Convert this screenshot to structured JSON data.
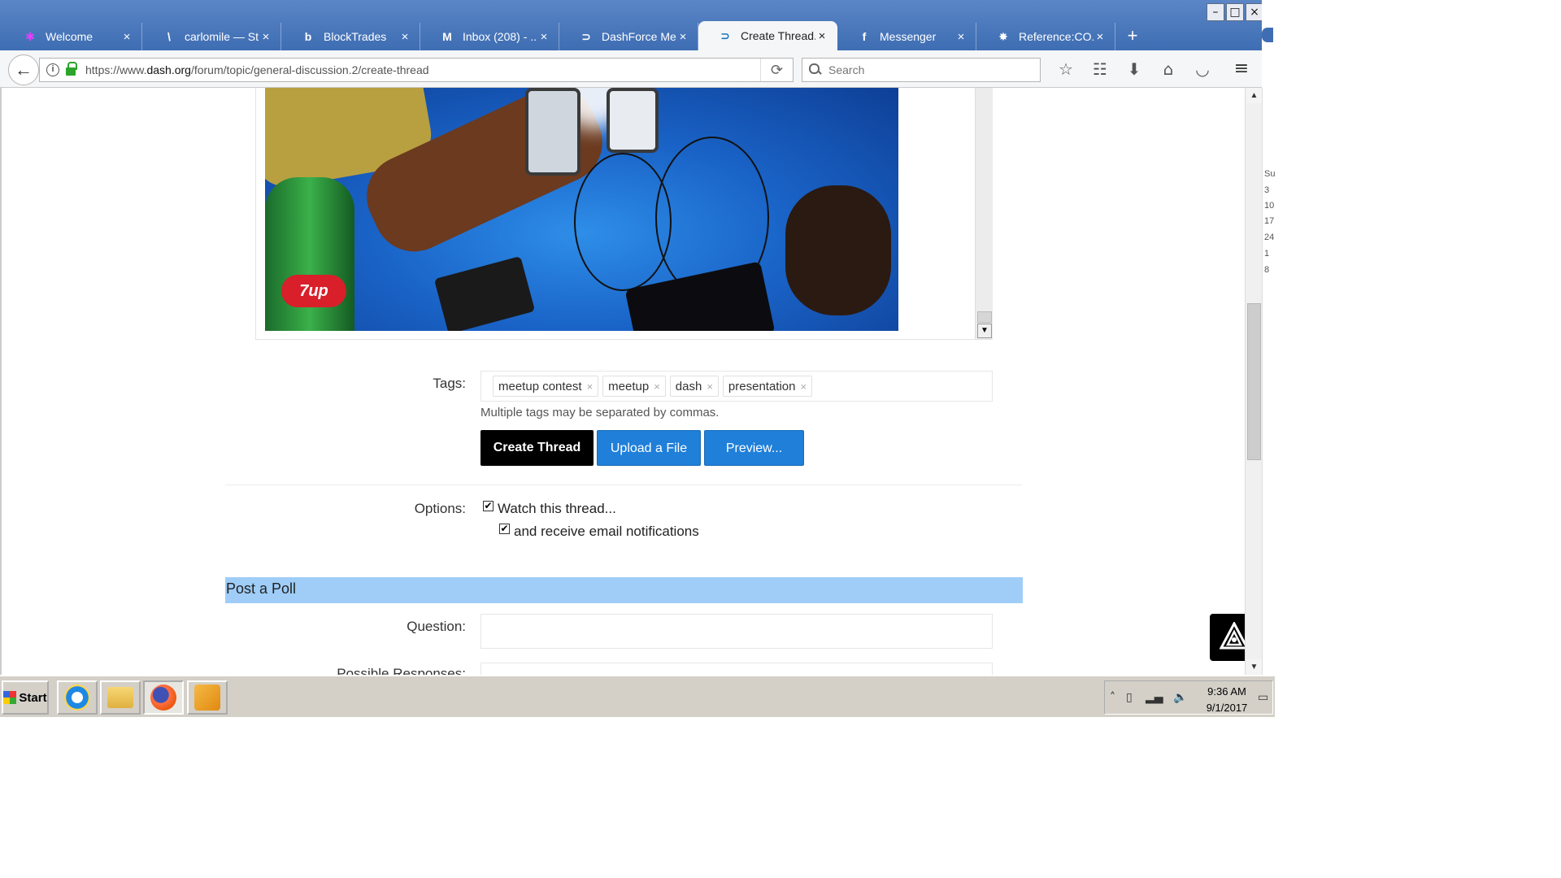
{
  "browser": {
    "tabs": [
      {
        "label": "Welcome",
        "icon": "asterisk-icon",
        "active": false
      },
      {
        "label": "carlomile — St...",
        "icon": "steemit-icon",
        "active": false
      },
      {
        "label": "BlockTrades",
        "icon": "blocktrades-icon",
        "active": false
      },
      {
        "label": "Inbox (208) - ...",
        "icon": "gmail-icon",
        "active": false
      },
      {
        "label": "DashForce Me...",
        "icon": "dash-icon",
        "active": false
      },
      {
        "label": "Create Thread...",
        "icon": "dash-icon",
        "active": true
      },
      {
        "label": "Messenger",
        "icon": "facebook-icon",
        "active": false
      },
      {
        "label": "Reference:CO...",
        "icon": "reference-icon",
        "active": false
      }
    ],
    "url_prefix": "https://www.",
    "url_domain": "dash.org",
    "url_path": "/forum/topic/general-discussion.2/create-thread",
    "search_placeholder": "Search",
    "accent": "#3e6db3"
  },
  "form": {
    "tags_label": "Tags:",
    "tags": [
      "meetup contest",
      "meetup",
      "dash",
      "presentation"
    ],
    "tag_remove": "×",
    "tags_hint": "Multiple tags may be separated by commas.",
    "buttons": {
      "create": "Create Thread",
      "upload": "Upload a File",
      "preview": "Preview..."
    },
    "options_label": "Options:",
    "options": [
      {
        "label": "Watch this thread...",
        "checked": true
      },
      {
        "label": "and receive email notifications",
        "checked": true
      }
    ],
    "poll_header": "Post a Poll",
    "question_label": "Question:",
    "responses_label": "Possible Responses:",
    "button_color": "#1f7fd9"
  },
  "photo": {
    "bottle_label": "7up"
  },
  "sidestrip_numbers": [
    "Su",
    "3",
    "10",
    "17",
    "24",
    "1",
    "8"
  ],
  "taskbar": {
    "start": "Start",
    "apps": [
      "internet-explorer-icon",
      "file-explorer-icon",
      "firefox-icon",
      "outlook-icon"
    ],
    "time": "9:36 AM",
    "date": "9/1/2017"
  }
}
